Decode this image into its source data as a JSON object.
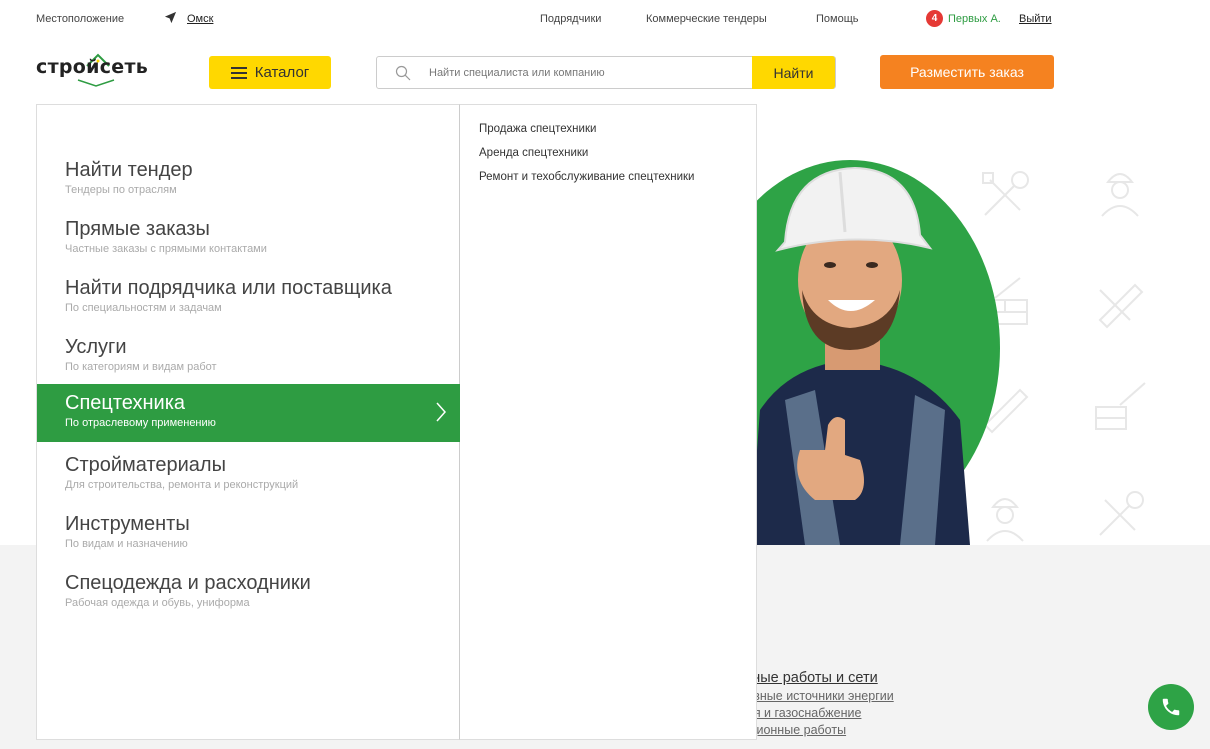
{
  "topbar": {
    "location_label": "Местоположение",
    "city": "Омск",
    "nav": [
      "Подрядчики",
      "Коммерческие тендеры",
      "Помощь"
    ],
    "notifications_count": "4",
    "user_name": "Первых А.",
    "logout": "Выйти"
  },
  "header": {
    "logo_text": "стройсеть",
    "catalog_label": "Каталог",
    "search_placeholder": "Найти специалиста или компанию",
    "search_button": "Найти",
    "order_button": "Разместить заказ"
  },
  "catalog_menu": {
    "items": [
      {
        "title": "Найти тендер",
        "subtitle": "Тендеры по отраслям"
      },
      {
        "title": "Прямые заказы",
        "subtitle": "Частные заказы с прямыми контактами"
      },
      {
        "title": "Найти подрядчика или поставщика",
        "subtitle": "По специальностям и задачам"
      },
      {
        "title": "Услуги",
        "subtitle": "По категориям и видам работ"
      },
      {
        "title": "Спецтехника",
        "subtitle": "По отраслевому применению"
      },
      {
        "title": "Стройматериалы",
        "subtitle": "Для строительства, ремонта и реконструкций"
      },
      {
        "title": "Инструменты",
        "subtitle": "По видам и назначению"
      },
      {
        "title": "Спецодежда и расходники",
        "subtitle": "Рабочая одежда и обувь, униформа"
      }
    ],
    "active_index": 4,
    "submenu": [
      "Продажа спецтехники",
      "Аренда спецтехники",
      "Ремонт и техобслуживание спецтехники"
    ]
  },
  "background_links": {
    "heading": "енерные работы и сети",
    "items": [
      "рнативные источники энергии",
      "икация и газоснабжение",
      "Изоляционные работы"
    ]
  },
  "colors": {
    "accent_green": "#2e9c42",
    "catalog_yellow": "#ffd800",
    "order_orange": "#f58220",
    "badge_red": "#e53935"
  }
}
